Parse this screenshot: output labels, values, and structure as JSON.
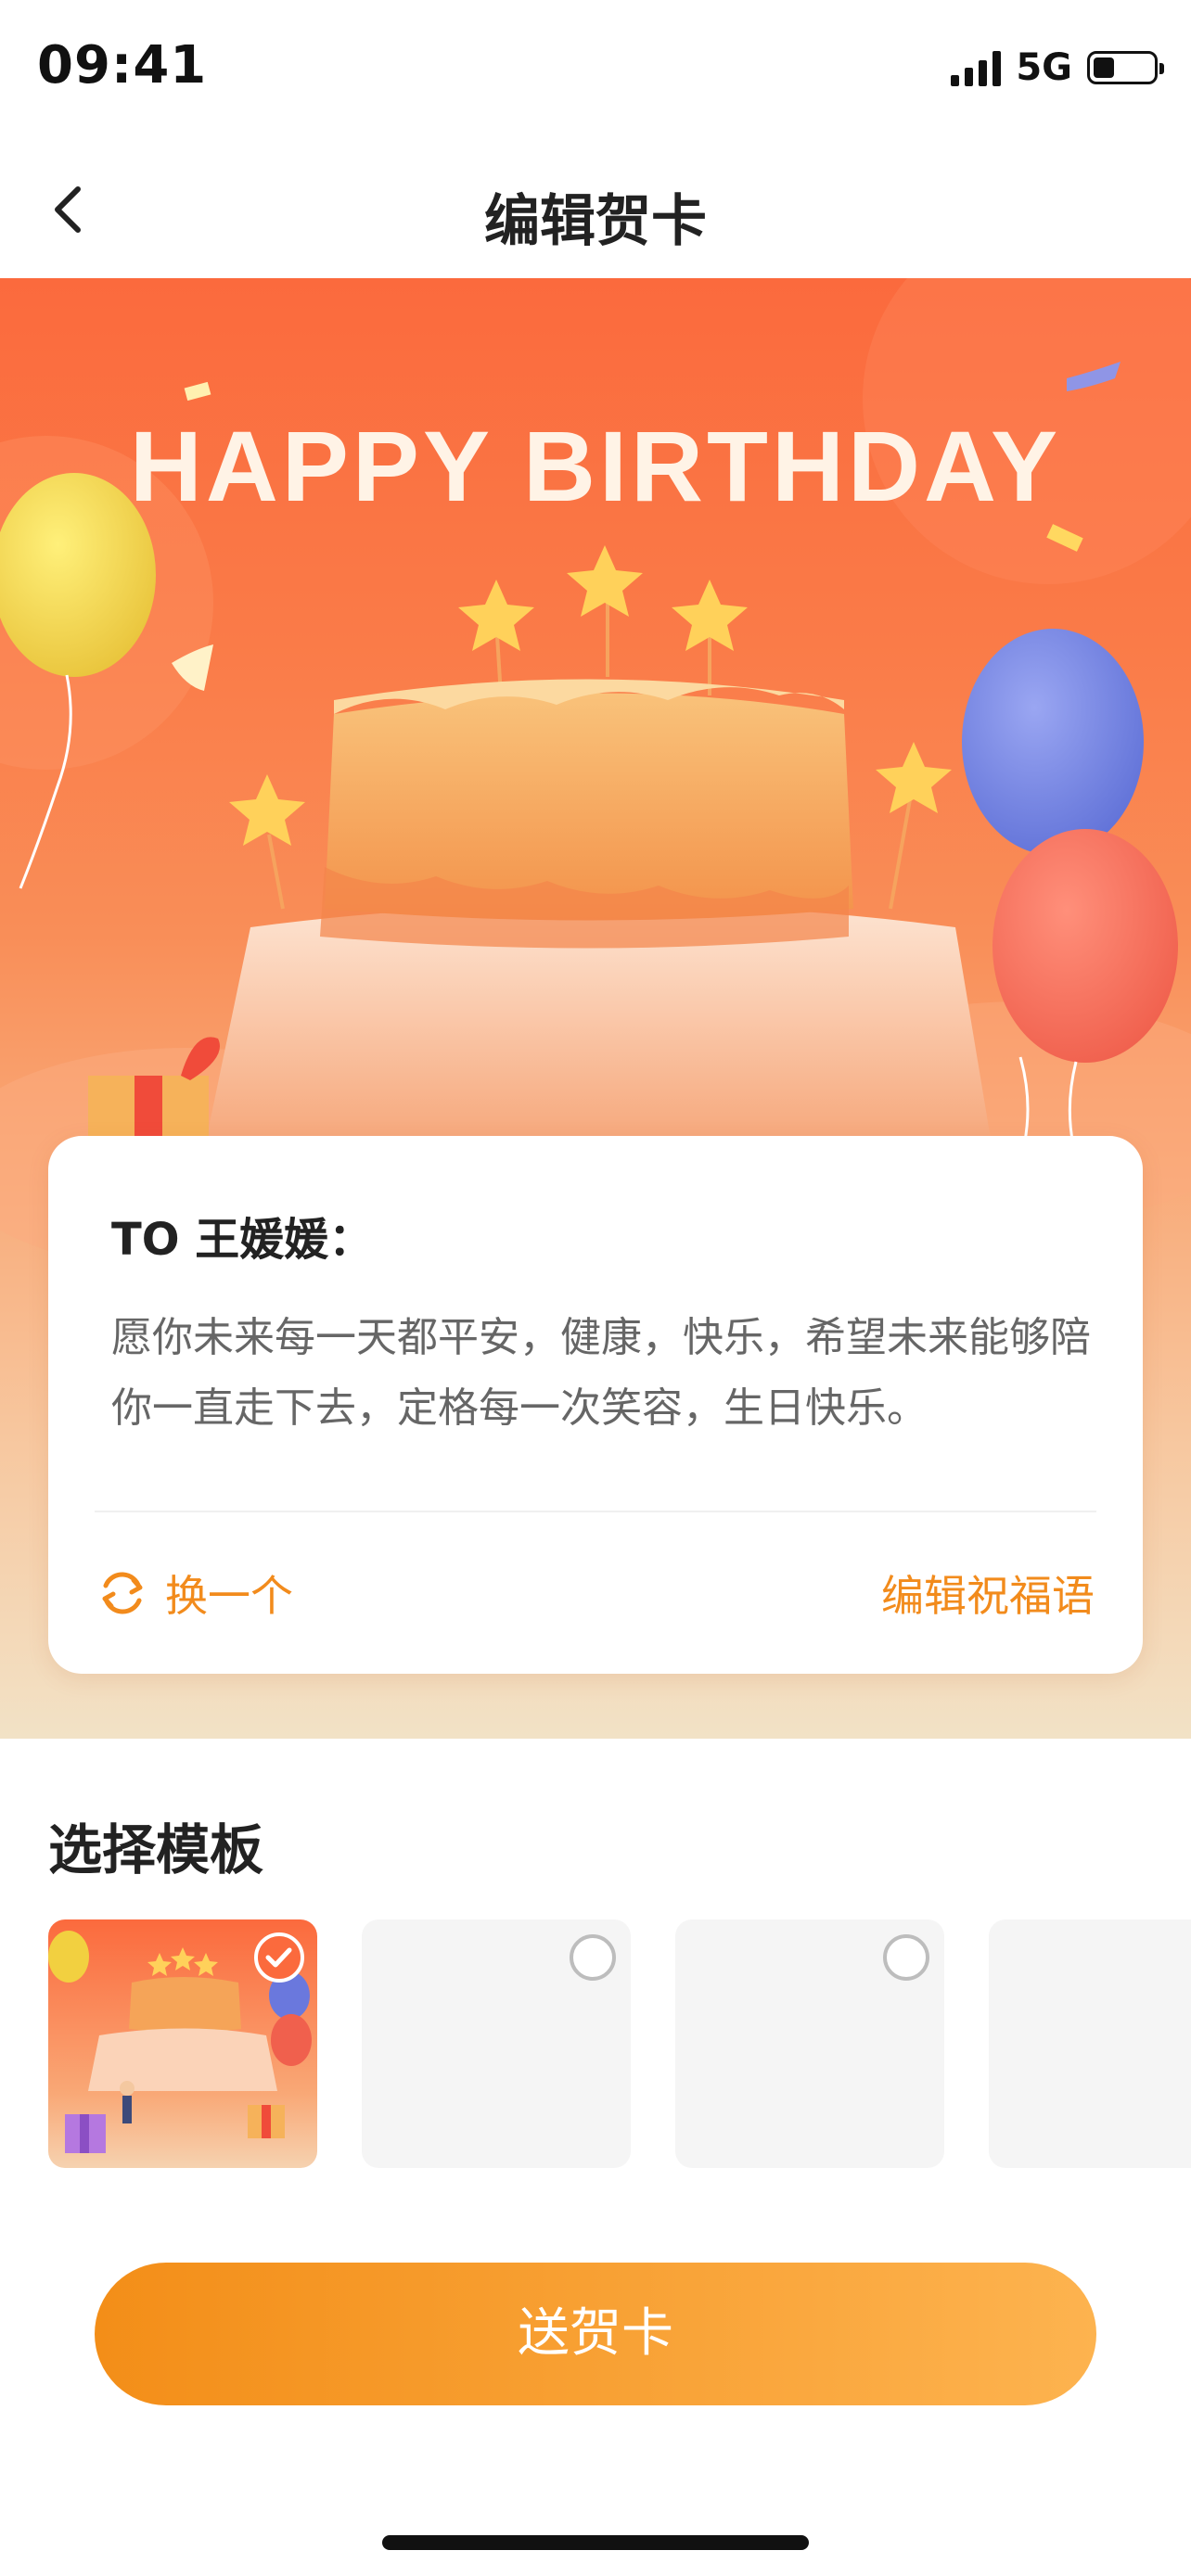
{
  "status_bar": {
    "time": "09:41",
    "network": "5G"
  },
  "nav": {
    "title": "编辑贺卡",
    "back_icon": "chevron-left-icon"
  },
  "hero": {
    "headline": "HAPPY BIRTHDAY"
  },
  "card": {
    "to_line": "TO 王媛媛：",
    "message": "愿你未来每一天都平安，健康，快乐，希望未来能够陪你一直走下去，定格每一次笑容，生日快乐。",
    "swap_label": "换一个",
    "edit_label": "编辑祝福语"
  },
  "templates": {
    "title": "选择模板",
    "items": [
      {
        "selected": true
      },
      {
        "selected": false
      },
      {
        "selected": false
      },
      {
        "selected": false
      }
    ]
  },
  "send_button": {
    "label": "送贺卡"
  },
  "colors": {
    "accent": "#f28b1c",
    "hero_top": "#fb6a3d",
    "button_start": "#f38e18",
    "button_end": "#fdb34f"
  }
}
